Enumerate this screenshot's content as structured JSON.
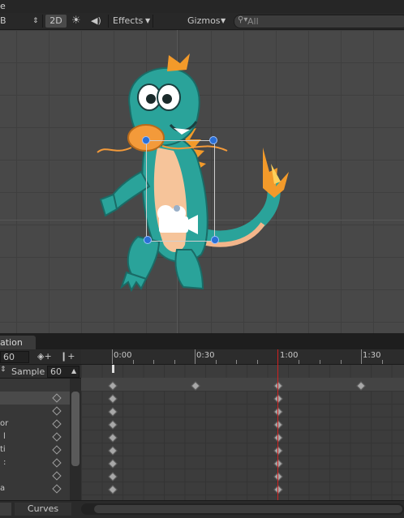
{
  "window": {
    "title_fragment": "e"
  },
  "scene_toolbar": {
    "shading_mode_fragment": "B",
    "mode_2d_label": "2D",
    "effects_label": "Effects",
    "gizmos_label": "Gizmos",
    "search_placeholder": "All"
  },
  "animation": {
    "tab_label_fragment": "ation",
    "frame_value": "60",
    "sample_label": "Sample",
    "sample_value": "60",
    "ruler_labels": [
      "0:00",
      "0:30",
      "1:00",
      "1:30"
    ],
    "property_rows": [
      {
        "label": ""
      },
      {
        "label": ""
      },
      {
        "label": "or"
      },
      {
        "label": "l"
      },
      {
        "label": "ti"
      },
      {
        "label": ":"
      },
      {
        "label": ""
      },
      {
        "label": "a"
      }
    ],
    "curves_tab_label": "Curves"
  },
  "colors": {
    "playhead": "#d02020",
    "selection_handle": "#2a6fd6"
  }
}
